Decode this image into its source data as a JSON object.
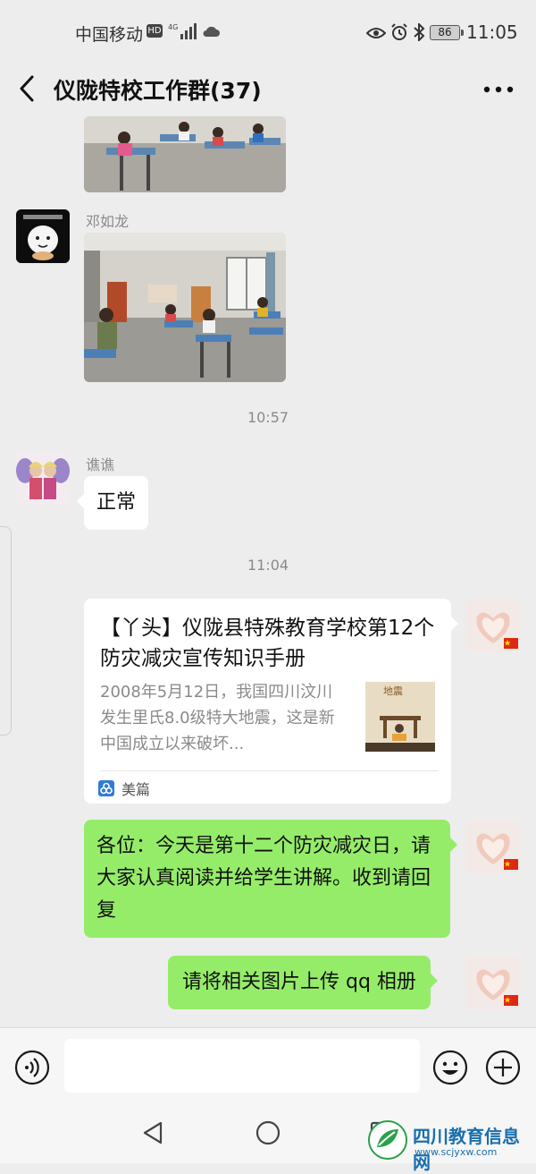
{
  "status_bar": {
    "carrier": "中国移动",
    "hd_badge": "HD",
    "network": "4G",
    "battery": "86",
    "time": "11:05"
  },
  "header": {
    "title": "仪陇特校工作群(37)",
    "back_icon": "chevron-left-icon",
    "more_icon": "more-dots-icon"
  },
  "messages": [
    {
      "type": "image",
      "side": "in",
      "content": "classroom photo"
    },
    {
      "type": "image",
      "side": "in",
      "sender": "邓如龙",
      "content": "classroom photo"
    },
    {
      "type": "time",
      "text": "10:57"
    },
    {
      "type": "text",
      "side": "in",
      "sender": "谯谯",
      "text": "正常"
    },
    {
      "type": "time",
      "text": "11:04"
    },
    {
      "type": "link_card",
      "side": "out",
      "title": "【丫头】仪陇县特殊教育学校第12个防灾减灾宣传知识手册",
      "description": "2008年5月12日，我国四川汶川发生里氏8.0级特大地震，这是新中国成立以来破坏...",
      "source": "美篇",
      "thumb_label": "地震"
    },
    {
      "type": "text",
      "side": "out",
      "text": "各位：今天是第十二个防灾减灾日，请大家认真阅读并给学生讲解。收到请回复"
    },
    {
      "type": "text",
      "side": "out",
      "text": "请将相关图片上传 qq 相册"
    }
  ],
  "input_bar": {
    "placeholder": "",
    "voice_icon": "voice-icon",
    "emoji_icon": "emoji-icon",
    "plus_icon": "plus-icon"
  },
  "watermark": {
    "name": "四川教育信息网",
    "url": "www.scjyxw.com"
  },
  "colors": {
    "background": "#ededed",
    "outgoing_bubble": "#95ec69",
    "incoming_bubble": "#ffffff",
    "watermark": "#1a6fae"
  }
}
